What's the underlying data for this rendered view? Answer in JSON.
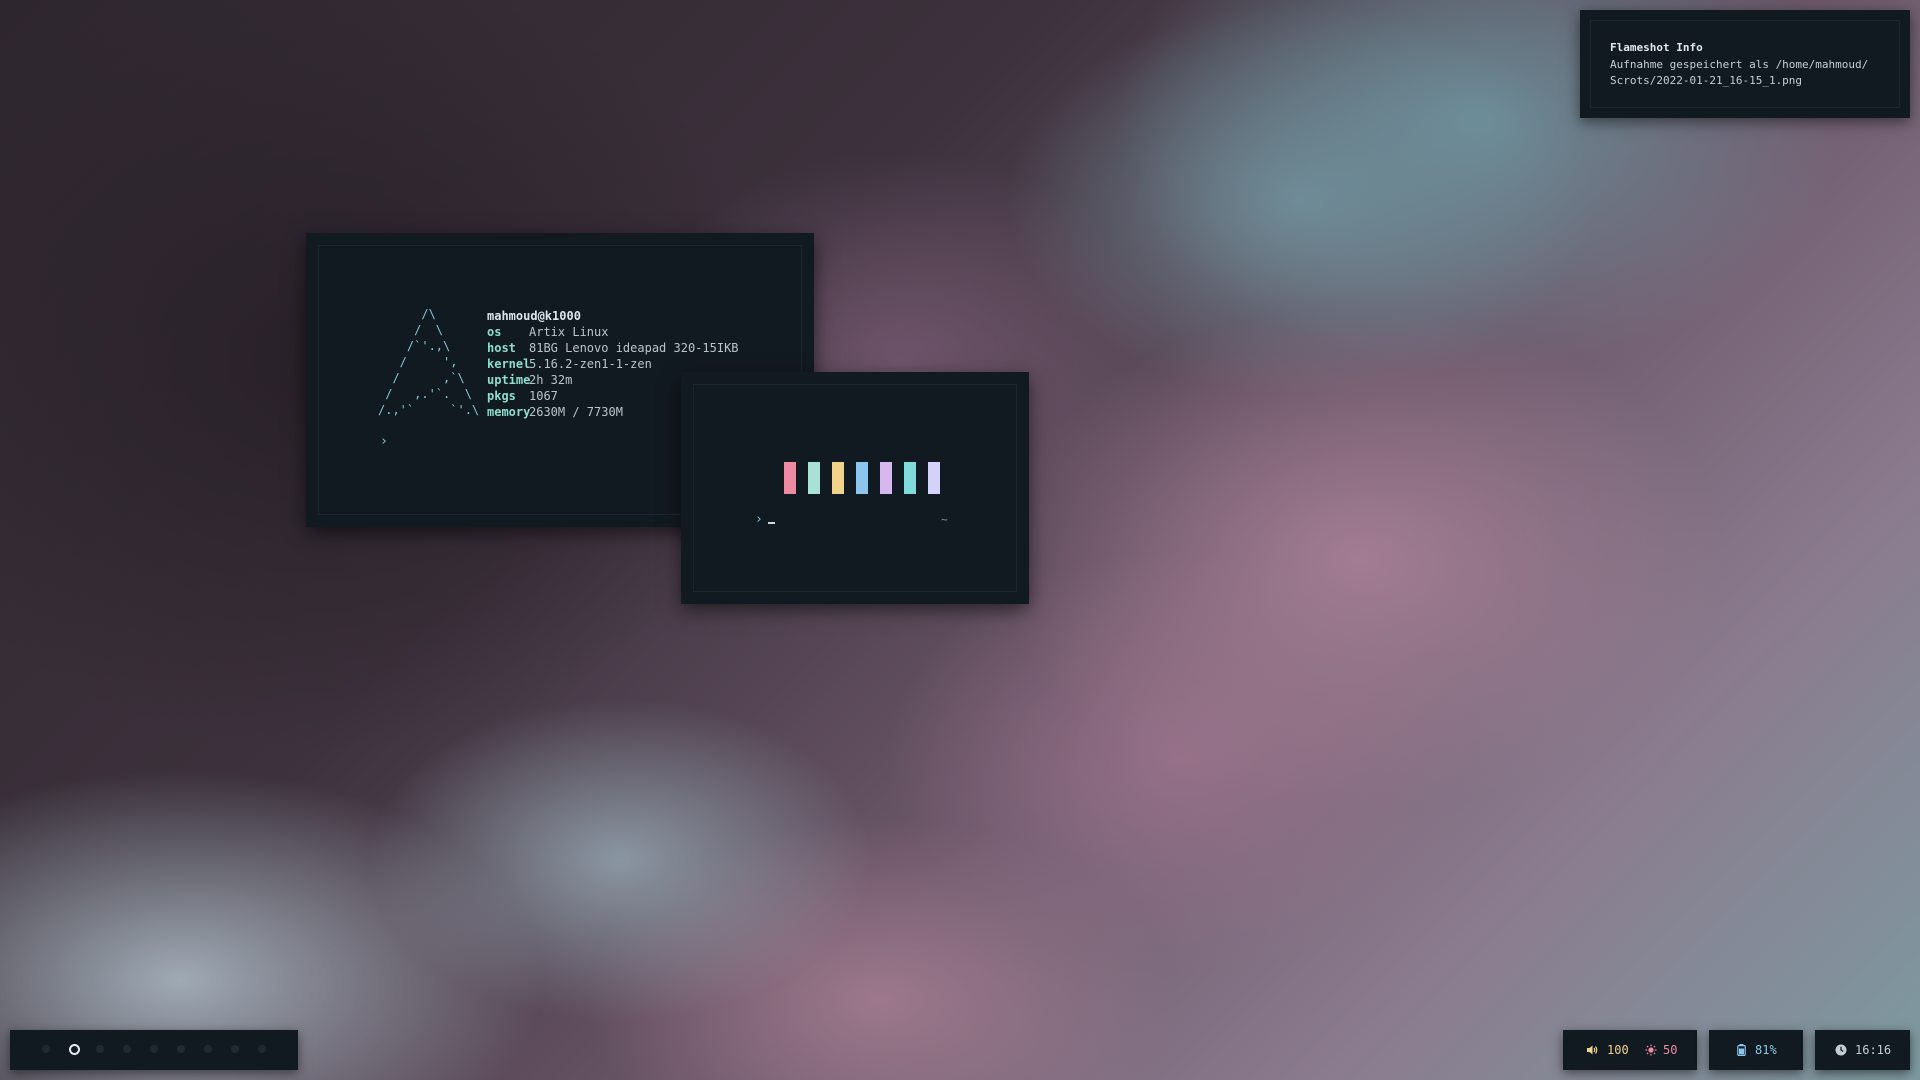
{
  "fetch": {
    "ascii_logo": "      /\\\n     /  \\\n    /`'.,\\\n   /     ',\n  /      ,`\\\n /   ,.'`.  \\\n/.,'`     `'.\\",
    "user": "mahmoud@k1000",
    "rows": [
      {
        "key": "os",
        "value": "Artix Linux"
      },
      {
        "key": "host",
        "value": "81BG Lenovo ideapad 320-15IKB"
      },
      {
        "key": "kernel",
        "value": "5.16.2-zen1-1-zen"
      },
      {
        "key": "uptime",
        "value": "2h 32m"
      },
      {
        "key": "pkgs",
        "value": "1067"
      },
      {
        "key": "memory",
        "value": "2630M / 7730M"
      }
    ],
    "prompt": "›"
  },
  "colors": {
    "swatches": [
      "#121a21",
      "#ee8ba3",
      "#a9e2d4",
      "#f2d38a",
      "#8cc5ee",
      "#d6b7ee",
      "#7fdcda",
      "#d4d2f8"
    ],
    "prompt": "›",
    "cwd": "~"
  },
  "notification": {
    "title": "Flameshot Info",
    "body": "Aufnahme gespeichert als /home/mahmoud/\nScrots/2022-01-21_16-15_1.png"
  },
  "bar": {
    "workspaces": [
      {
        "active": false
      },
      {
        "active": true
      },
      {
        "active": false
      },
      {
        "active": false
      },
      {
        "active": false
      },
      {
        "active": false
      },
      {
        "active": false
      },
      {
        "active": false
      },
      {
        "active": false
      }
    ],
    "volume": "100",
    "brightness": "50",
    "battery": "81%",
    "clock": "16:16",
    "icons": {
      "volume": "volume-icon",
      "brightness": "brightness-icon",
      "battery": "battery-icon",
      "clock": "clock-icon"
    },
    "colors": {
      "volume": "#f2d38a",
      "brightness": "#ee8ba3",
      "battery": "#8cc5ee",
      "clock": "#c6ced5"
    }
  }
}
